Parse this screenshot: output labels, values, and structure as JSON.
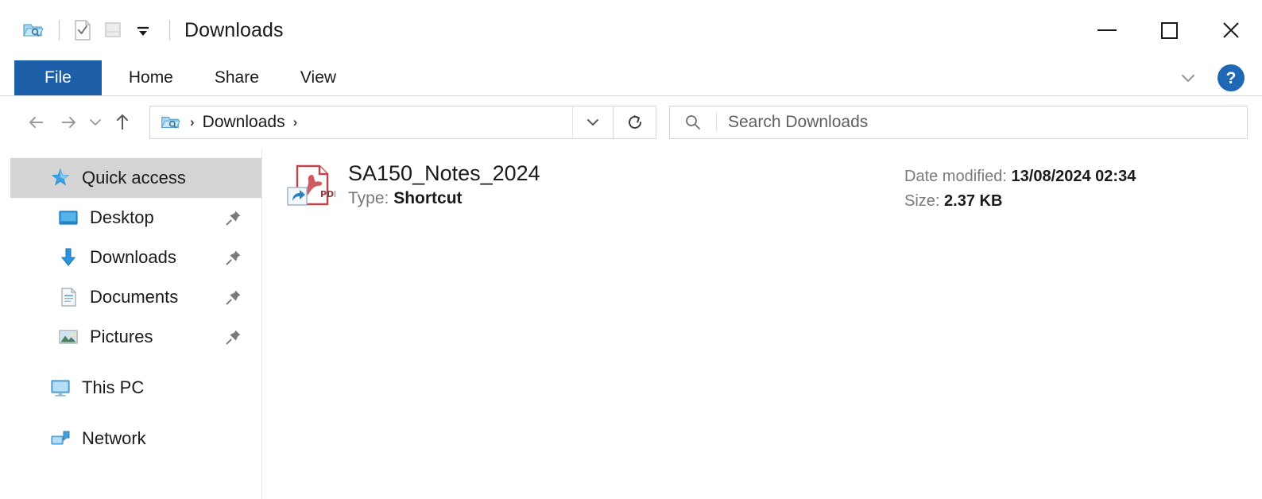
{
  "window": {
    "title": "Downloads",
    "accent_blue": "#1e5fa9",
    "selection_gray": "#d4d4d4"
  },
  "quick_access_toolbar": {
    "app_icon": "folder-explorer-icon",
    "items": [
      {
        "name": "properties-icon",
        "label": "Properties"
      },
      {
        "name": "new-folder-icon",
        "label": "New folder"
      },
      {
        "name": "customize-qat-dropdown-icon",
        "label": "Customize Quick Access Toolbar"
      }
    ]
  },
  "window_controls": {
    "minimize": "minimize-icon",
    "maximize": "maximize-icon",
    "close": "close-icon"
  },
  "ribbon": {
    "tabs": [
      {
        "label": "File",
        "selected": true
      },
      {
        "label": "Home",
        "selected": false
      },
      {
        "label": "Share",
        "selected": false
      },
      {
        "label": "View",
        "selected": false
      }
    ],
    "expand_icon": "chevron-down-icon",
    "help_label": "?"
  },
  "navbar": {
    "back_icon": "arrow-left-icon",
    "forward_icon": "arrow-right-icon",
    "recent_icon": "chevron-down-icon",
    "up_icon": "arrow-up-icon",
    "address": {
      "folder_icon": "folder-explorer-icon",
      "separator": "›",
      "crumbs": [
        "Downloads"
      ],
      "dropdown_icon": "chevron-down-icon",
      "refresh_icon": "refresh-icon"
    },
    "search": {
      "icon": "search-icon",
      "placeholder": "Search Downloads",
      "value": ""
    }
  },
  "navpane": {
    "items": [
      {
        "label": "Quick access",
        "icon": "star-pin-icon",
        "selected": true,
        "pinned": false,
        "indent": 1
      },
      {
        "label": "Desktop",
        "icon": "desktop-icon",
        "selected": false,
        "pinned": true,
        "indent": 2
      },
      {
        "label": "Downloads",
        "icon": "download-arrow-icon",
        "selected": false,
        "pinned": true,
        "indent": 2
      },
      {
        "label": "Documents",
        "icon": "documents-icon",
        "selected": false,
        "pinned": true,
        "indent": 2
      },
      {
        "label": "Pictures",
        "icon": "pictures-icon",
        "selected": false,
        "pinned": true,
        "indent": 2
      },
      {
        "label": "This PC",
        "icon": "this-pc-icon",
        "selected": false,
        "pinned": false,
        "indent": 1
      },
      {
        "label": "Network",
        "icon": "network-icon",
        "selected": false,
        "pinned": false,
        "indent": 1
      }
    ],
    "pin_icon": "pin-icon"
  },
  "content": {
    "files": [
      {
        "name": "SA150_Notes_2024",
        "icon": "pdf-shortcut-icon",
        "type_label": "Type:",
        "type_value": "Shortcut",
        "date_label": "Date modified:",
        "date_value": "13/08/2024 02:34",
        "size_label": "Size:",
        "size_value": "2.37 KB"
      }
    ]
  }
}
